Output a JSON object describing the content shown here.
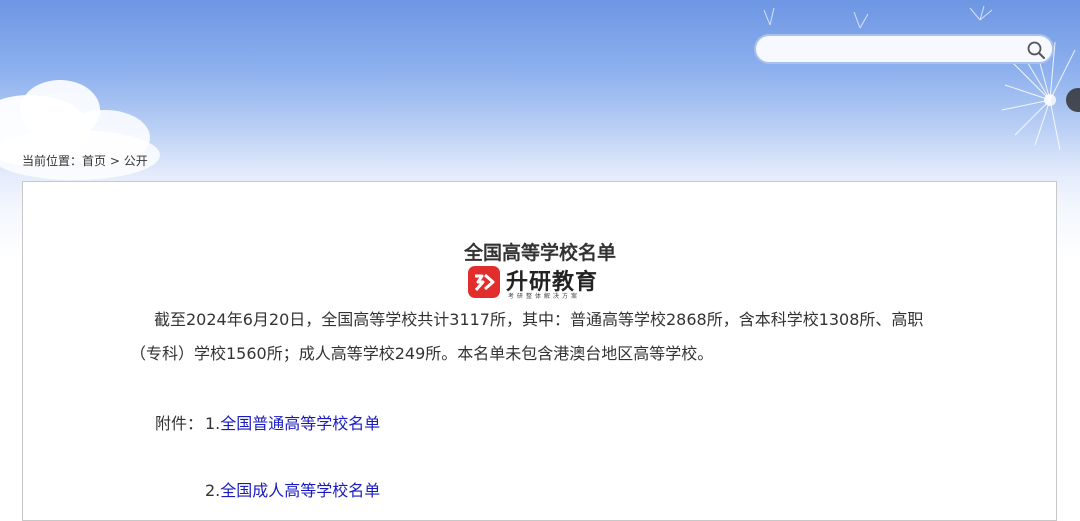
{
  "search": {
    "placeholder": "",
    "value": "",
    "icon": "search-icon"
  },
  "breadcrumb": {
    "prefix": "当前位置：",
    "home": "首页",
    "separator": ">",
    "current": "公开"
  },
  "article": {
    "title": "全国高等学校名单",
    "logo": {
      "name": "升研教育",
      "tagline": "考研整体解决方案"
    },
    "paragraph_line1": "截至2024年6月20日，全国高等学校共计3117所，其中：普通高等学校2868所，含本科学校1308所、高职",
    "paragraph_line2": "（专科）学校1560所；成人高等学校249所。本名单未包含港澳台地区高等学校。",
    "attachments_label": "附件：",
    "attachments": [
      {
        "num": "1.",
        "label": "全国普通高等学校名单"
      },
      {
        "num": "2.",
        "label": "全国成人高等学校名单"
      }
    ]
  },
  "colors": {
    "link": "#1a1ac2",
    "logo_red": "#e22d2d",
    "sky_top": "#6d96e3"
  }
}
